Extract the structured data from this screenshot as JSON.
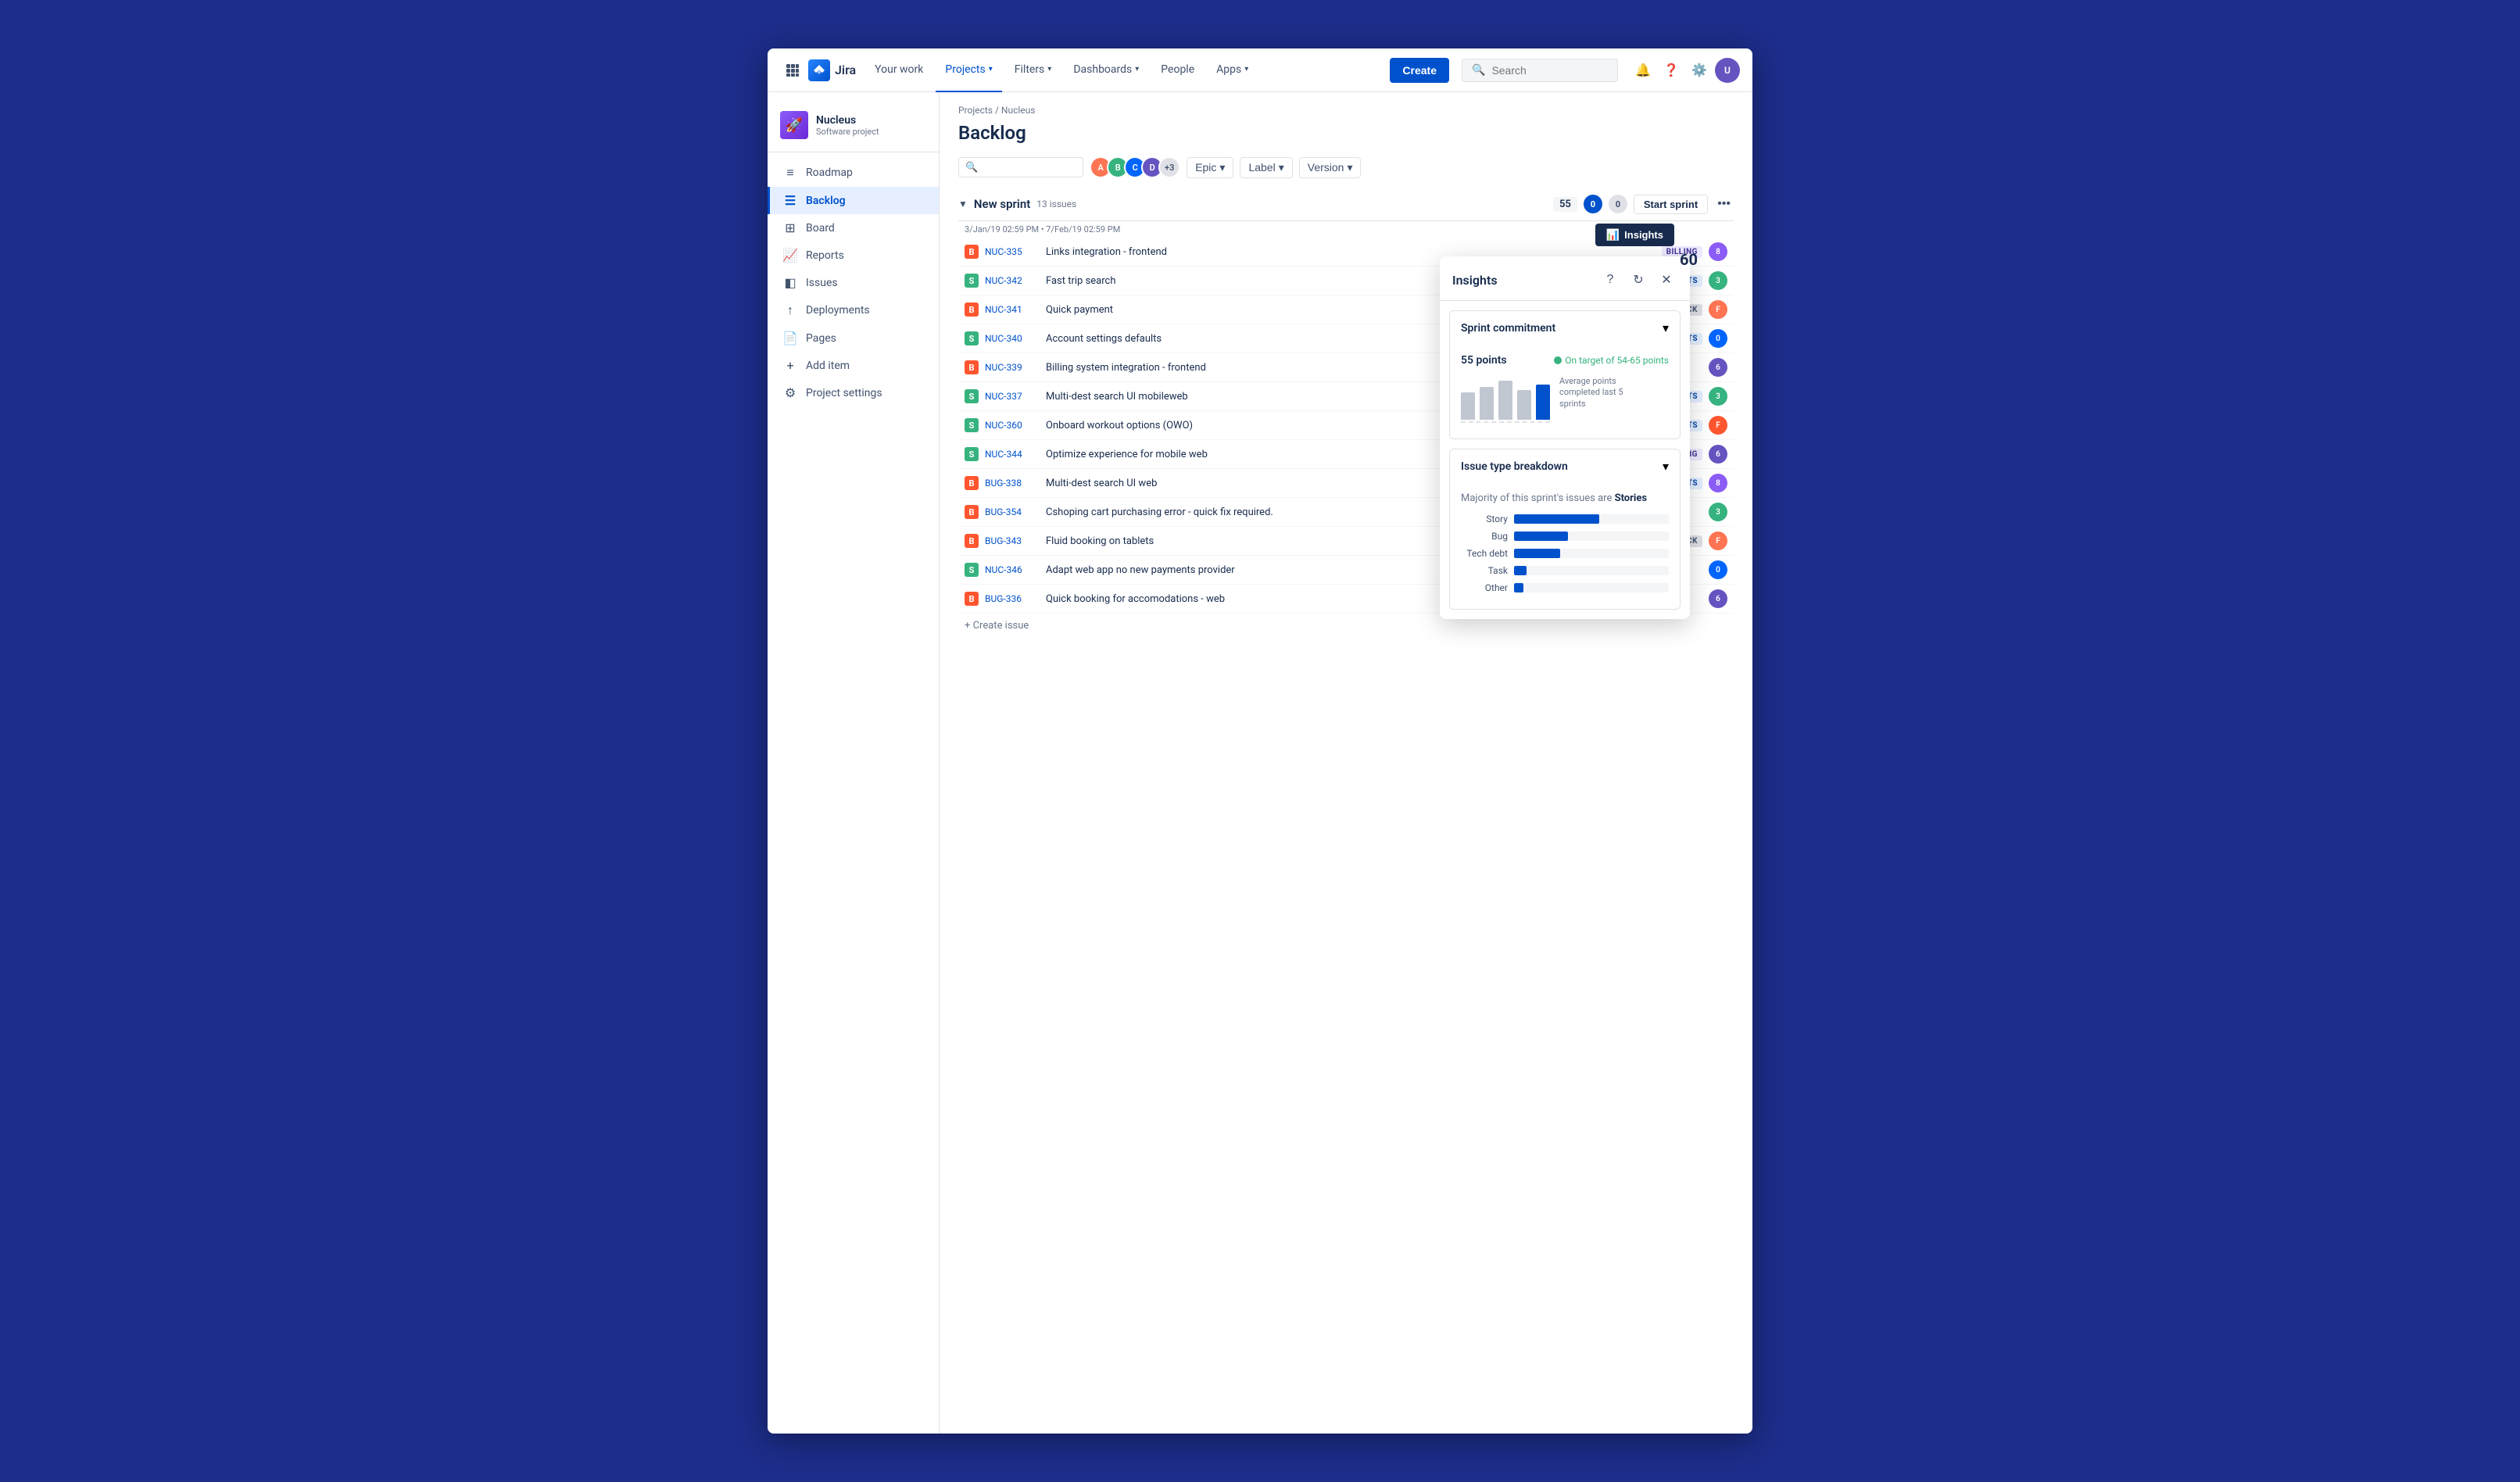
{
  "topNav": {
    "logo": "Jira",
    "items": [
      {
        "id": "your-work",
        "label": "Your work",
        "active": false,
        "hasChevron": false
      },
      {
        "id": "projects",
        "label": "Projects",
        "active": true,
        "hasChevron": true
      },
      {
        "id": "filters",
        "label": "Filters",
        "active": false,
        "hasChevron": true
      },
      {
        "id": "dashboards",
        "label": "Dashboards",
        "active": false,
        "hasChevron": true
      },
      {
        "id": "people",
        "label": "People",
        "active": false,
        "hasChevron": false
      },
      {
        "id": "apps",
        "label": "Apps",
        "active": false,
        "hasChevron": true
      }
    ],
    "createBtn": "Create",
    "search": {
      "placeholder": "Search"
    }
  },
  "sidebar": {
    "project": {
      "name": "Nucleus",
      "type": "Software project",
      "icon": "🚀"
    },
    "items": [
      {
        "id": "roadmap",
        "label": "Roadmap",
        "icon": "≡",
        "active": false
      },
      {
        "id": "backlog",
        "label": "Backlog",
        "icon": "☰",
        "active": true
      },
      {
        "id": "board",
        "label": "Board",
        "icon": "⊞",
        "active": false
      },
      {
        "id": "reports",
        "label": "Reports",
        "icon": "📈",
        "active": false
      },
      {
        "id": "issues",
        "label": "Issues",
        "icon": "◧",
        "active": false
      },
      {
        "id": "deployments",
        "label": "Deployments",
        "icon": "↑",
        "active": false
      },
      {
        "id": "pages",
        "label": "Pages",
        "icon": "📄",
        "active": false
      },
      {
        "id": "add-item",
        "label": "Add item",
        "icon": "+",
        "active": false
      },
      {
        "id": "project-settings",
        "label": "Project settings",
        "icon": "⚙",
        "active": false
      }
    ]
  },
  "breadcrumb": {
    "parts": [
      "Projects",
      "Nucleus"
    ],
    "separator": "/"
  },
  "page": {
    "title": "Backlog"
  },
  "toolbar": {
    "epicBtn": "Epic",
    "labelBtn": "Label",
    "versionBtn": "Version",
    "avatarCount": "+3"
  },
  "sprint": {
    "name": "New sprint",
    "issueCount": "13 issues",
    "dates": "3/Jan/19 02:59 PM • 7/Feb/19 02:59 PM",
    "points": "55",
    "badgeBlue": "0",
    "badgeGray": "0",
    "startBtn": "Start sprint"
  },
  "issues": [
    {
      "key": "NUC-335",
      "title": "Links integration - frontend",
      "label": "BILLING",
      "labelType": "billing",
      "type": "bug",
      "avatarColor": "#8b5cf6"
    },
    {
      "key": "NUC-342",
      "title": "Fast trip search",
      "label": "ACCOUNTS",
      "labelType": "accounts",
      "type": "story",
      "avatarColor": "#36b37e"
    },
    {
      "key": "NUC-341",
      "title": "Quick payment",
      "label": "FEEDBACK",
      "labelType": "feedback",
      "type": "bug",
      "avatarColor": "#ff7452"
    },
    {
      "key": "NUC-340",
      "title": "Account settings defaults",
      "label": "ACCOUNTS",
      "labelType": "accounts",
      "type": "story",
      "avatarColor": "#0065ff"
    },
    {
      "key": "NUC-339",
      "title": "Billing system integration - frontend",
      "label": "",
      "labelType": "",
      "type": "bug",
      "avatarColor": "#6554c0"
    },
    {
      "key": "NUC-337",
      "title": "Multi-dest search UI mobileweb",
      "label": "ACCOUNTS",
      "labelType": "accounts",
      "type": "story",
      "avatarColor": "#36b37e"
    },
    {
      "key": "NUC-360",
      "title": "Onboard workout options (OWO)",
      "label": "ACCOUNTS",
      "labelType": "accounts",
      "type": "story",
      "avatarColor": "#ff5630"
    },
    {
      "key": "NUC-344",
      "title": "Optimize experience for mobile web",
      "label": "BILLING",
      "labelType": "billing",
      "type": "story",
      "avatarColor": "#6554c0"
    },
    {
      "key": "BUG-338",
      "title": "Multi-dest search UI web",
      "label": "ACCOUNTS",
      "labelType": "accounts",
      "type": "bug",
      "avatarColor": "#8b5cf6"
    },
    {
      "key": "BUG-354",
      "title": "Cshoping cart purchasing error - quick fix required.",
      "label": "",
      "labelType": "",
      "type": "bug",
      "avatarColor": "#36b37e"
    },
    {
      "key": "BUG-343",
      "title": "Fluid booking on tablets",
      "label": "FEEDBACK",
      "labelType": "feedback",
      "type": "bug",
      "avatarColor": "#ff7452"
    },
    {
      "key": "NUC-346",
      "title": "Adapt web app no new payments provider",
      "label": "",
      "labelType": "",
      "type": "story",
      "avatarColor": "#0065ff"
    },
    {
      "key": "BUG-336",
      "title": "Quick booking for accomodations - web",
      "label": "",
      "labelType": "",
      "type": "bug",
      "avatarColor": "#6554c0"
    }
  ],
  "createIssue": "+ Create issue",
  "insightsBtn": "Insights",
  "insights": {
    "title": "Insights",
    "sprintCommitment": {
      "title": "Sprint commitment",
      "points": "55 points",
      "onTarget": "On target of 54-65 points",
      "avgPoints": "60",
      "avgLabel": "Average points\ncompleted last 5 sprints"
    },
    "issueBreakdown": {
      "title": "Issue type breakdown",
      "subtitle": "Majority of this sprint's issues are",
      "majorType": "Stories",
      "rows": [
        {
          "label": "Story",
          "pct": 55
        },
        {
          "label": "Bug",
          "pct": 35
        },
        {
          "label": "Tech debt",
          "pct": 30
        },
        {
          "label": "Task",
          "pct": 8
        },
        {
          "label": "Other",
          "pct": 6
        }
      ]
    }
  },
  "barChart": {
    "bars": [
      {
        "height": 35,
        "current": false
      },
      {
        "height": 42,
        "current": false
      },
      {
        "height": 50,
        "current": false
      },
      {
        "height": 38,
        "current": false
      },
      {
        "height": 45,
        "current": true
      }
    ]
  }
}
